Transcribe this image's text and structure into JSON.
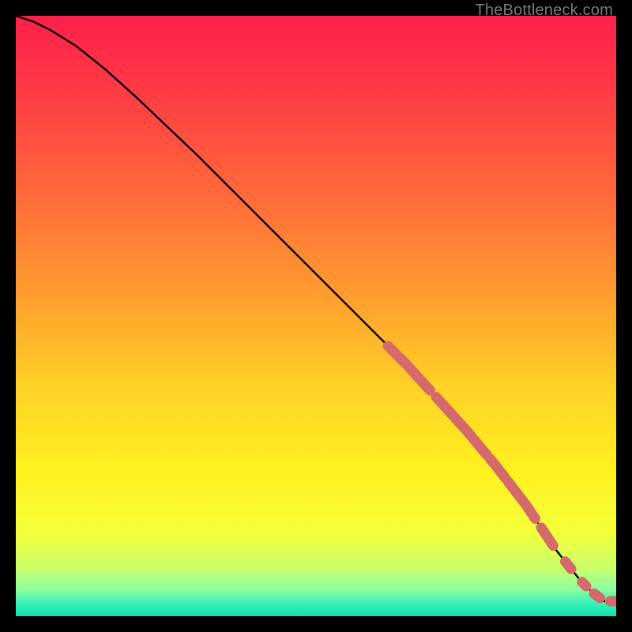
{
  "attribution": "TheBottleneck.com",
  "colors": {
    "gradient_stops": [
      {
        "offset": 0.0,
        "color": "#ff1f4b"
      },
      {
        "offset": 0.12,
        "color": "#ff3a45"
      },
      {
        "offset": 0.3,
        "color": "#ff6a3a"
      },
      {
        "offset": 0.48,
        "color": "#ffa22e"
      },
      {
        "offset": 0.62,
        "color": "#ffd226"
      },
      {
        "offset": 0.76,
        "color": "#fff11f"
      },
      {
        "offset": 0.86,
        "color": "#f5ff3a"
      },
      {
        "offset": 0.92,
        "color": "#c9ff6a"
      },
      {
        "offset": 0.955,
        "color": "#8effa0"
      },
      {
        "offset": 0.975,
        "color": "#45f3b8"
      },
      {
        "offset": 0.99,
        "color": "#1de9b6"
      },
      {
        "offset": 1.0,
        "color": "#14e0a8"
      }
    ],
    "curve": "#000000",
    "bead": "#d46a6a"
  },
  "chart_data": {
    "type": "line",
    "title": "",
    "xlabel": "",
    "ylabel": "",
    "xlim": [
      0,
      100
    ],
    "ylim": [
      0,
      100
    ],
    "grid": false,
    "legend": false,
    "series": [
      {
        "name": "curve",
        "x": [
          0,
          3,
          6,
          10,
          15,
          20,
          30,
          40,
          50,
          60,
          65,
          70,
          75,
          80,
          85,
          88,
          90,
          92,
          94,
          96,
          98,
          100
        ],
        "y": [
          100,
          99,
          97.5,
          95,
          91,
          86.5,
          77,
          67,
          57,
          47,
          42,
          36.5,
          31,
          25,
          18.5,
          14,
          11,
          8.5,
          6,
          4,
          2.5,
          2.5
        ]
      }
    ],
    "beads_on_curve": [
      {
        "x_start": 62,
        "x_end": 69,
        "thick": true
      },
      {
        "x_start": 69,
        "x_end": 70,
        "thick": false
      },
      {
        "x_start": 70,
        "x_end": 76,
        "thick": true
      },
      {
        "x_start": 76.3,
        "x_end": 78.5,
        "thick": true
      },
      {
        "x_start": 79,
        "x_end": 81.5,
        "thick": true
      },
      {
        "x_start": 82,
        "x_end": 86.5,
        "thick": true
      },
      {
        "x_start": 87.5,
        "x_end": 89.5,
        "thick": true
      },
      {
        "x_start": 91.5,
        "x_end": 92.5,
        "thick": true
      },
      {
        "x_start": 94.3,
        "x_end": 95.0,
        "thick": true
      },
      {
        "x_start": 96.3,
        "x_end": 97.3,
        "thick": true
      },
      {
        "x_start": 99.0,
        "x_end": 100.0,
        "thick": true
      }
    ]
  }
}
